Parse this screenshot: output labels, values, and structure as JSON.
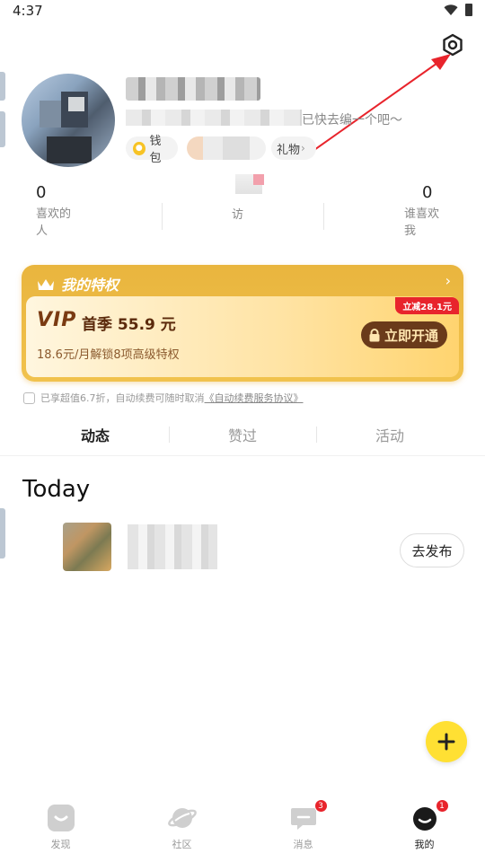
{
  "status_bar": {
    "time": "4:37"
  },
  "profile": {
    "bio_suffix": "已快去编一个吧～",
    "wallet_label": "钱包",
    "gift_label": "礼物"
  },
  "stats": {
    "likes": {
      "value": "0",
      "label": "喜欢的人"
    },
    "visitors": {
      "label": "访"
    },
    "liked_me": {
      "value": "0",
      "label": "谁喜欢我"
    }
  },
  "vip": {
    "header": "我的特权",
    "logo": "VIP",
    "title": "首季 55.9 元",
    "subtitle": "18.6元/月解锁8项高级特权",
    "ribbon": "立减28.1元",
    "button": "立即开通"
  },
  "agreement": {
    "text": "已享超值6.7折，自动续费可随时取消",
    "link": "《自动续费服务协议》"
  },
  "tabs": [
    "动态",
    "赞过",
    "活动"
  ],
  "feed": {
    "section_title": "Today",
    "publish_label": "去发布"
  },
  "bottom_nav": [
    {
      "label": "发现",
      "icon": "discover-icon"
    },
    {
      "label": "社区",
      "icon": "planet-icon"
    },
    {
      "label": "消息",
      "icon": "message-icon",
      "badge": "3"
    },
    {
      "label": "我的",
      "icon": "profile-face-icon",
      "badge": "1",
      "active": true
    }
  ],
  "colors": {
    "vip_gold": "#f1c24d",
    "vip_button": "#6a3a1a",
    "fab": "#ffe033",
    "badge": "#e8242c",
    "annotation_arrow": "#e8242c"
  }
}
